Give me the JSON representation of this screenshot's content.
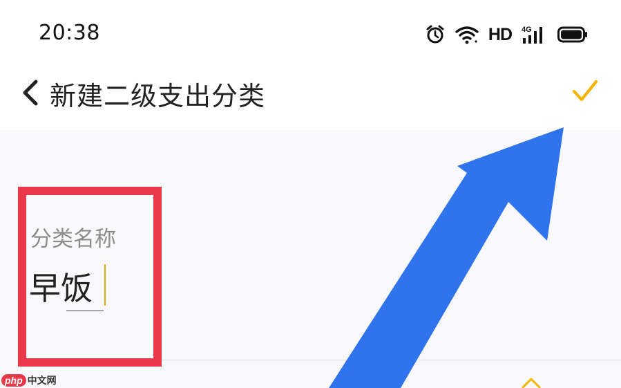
{
  "status_bar": {
    "time": "20:38",
    "network_label": "HD",
    "network_type": "4G",
    "icons": [
      "alarm-icon",
      "wifi-icon",
      "signal-icon",
      "battery-icon"
    ]
  },
  "header": {
    "title": "新建二级支出分类",
    "back_icon": "chevron-left-icon",
    "confirm_icon": "checkmark-icon"
  },
  "form": {
    "field_label": "分类名称",
    "field_value": "早饭"
  },
  "watermark": {
    "logo": "php",
    "text": "中文网"
  },
  "colors": {
    "accent": "#f5b400",
    "annotation_box": "#e8384a",
    "annotation_arrow": "#2f74ec",
    "caret": "#e0a800"
  }
}
